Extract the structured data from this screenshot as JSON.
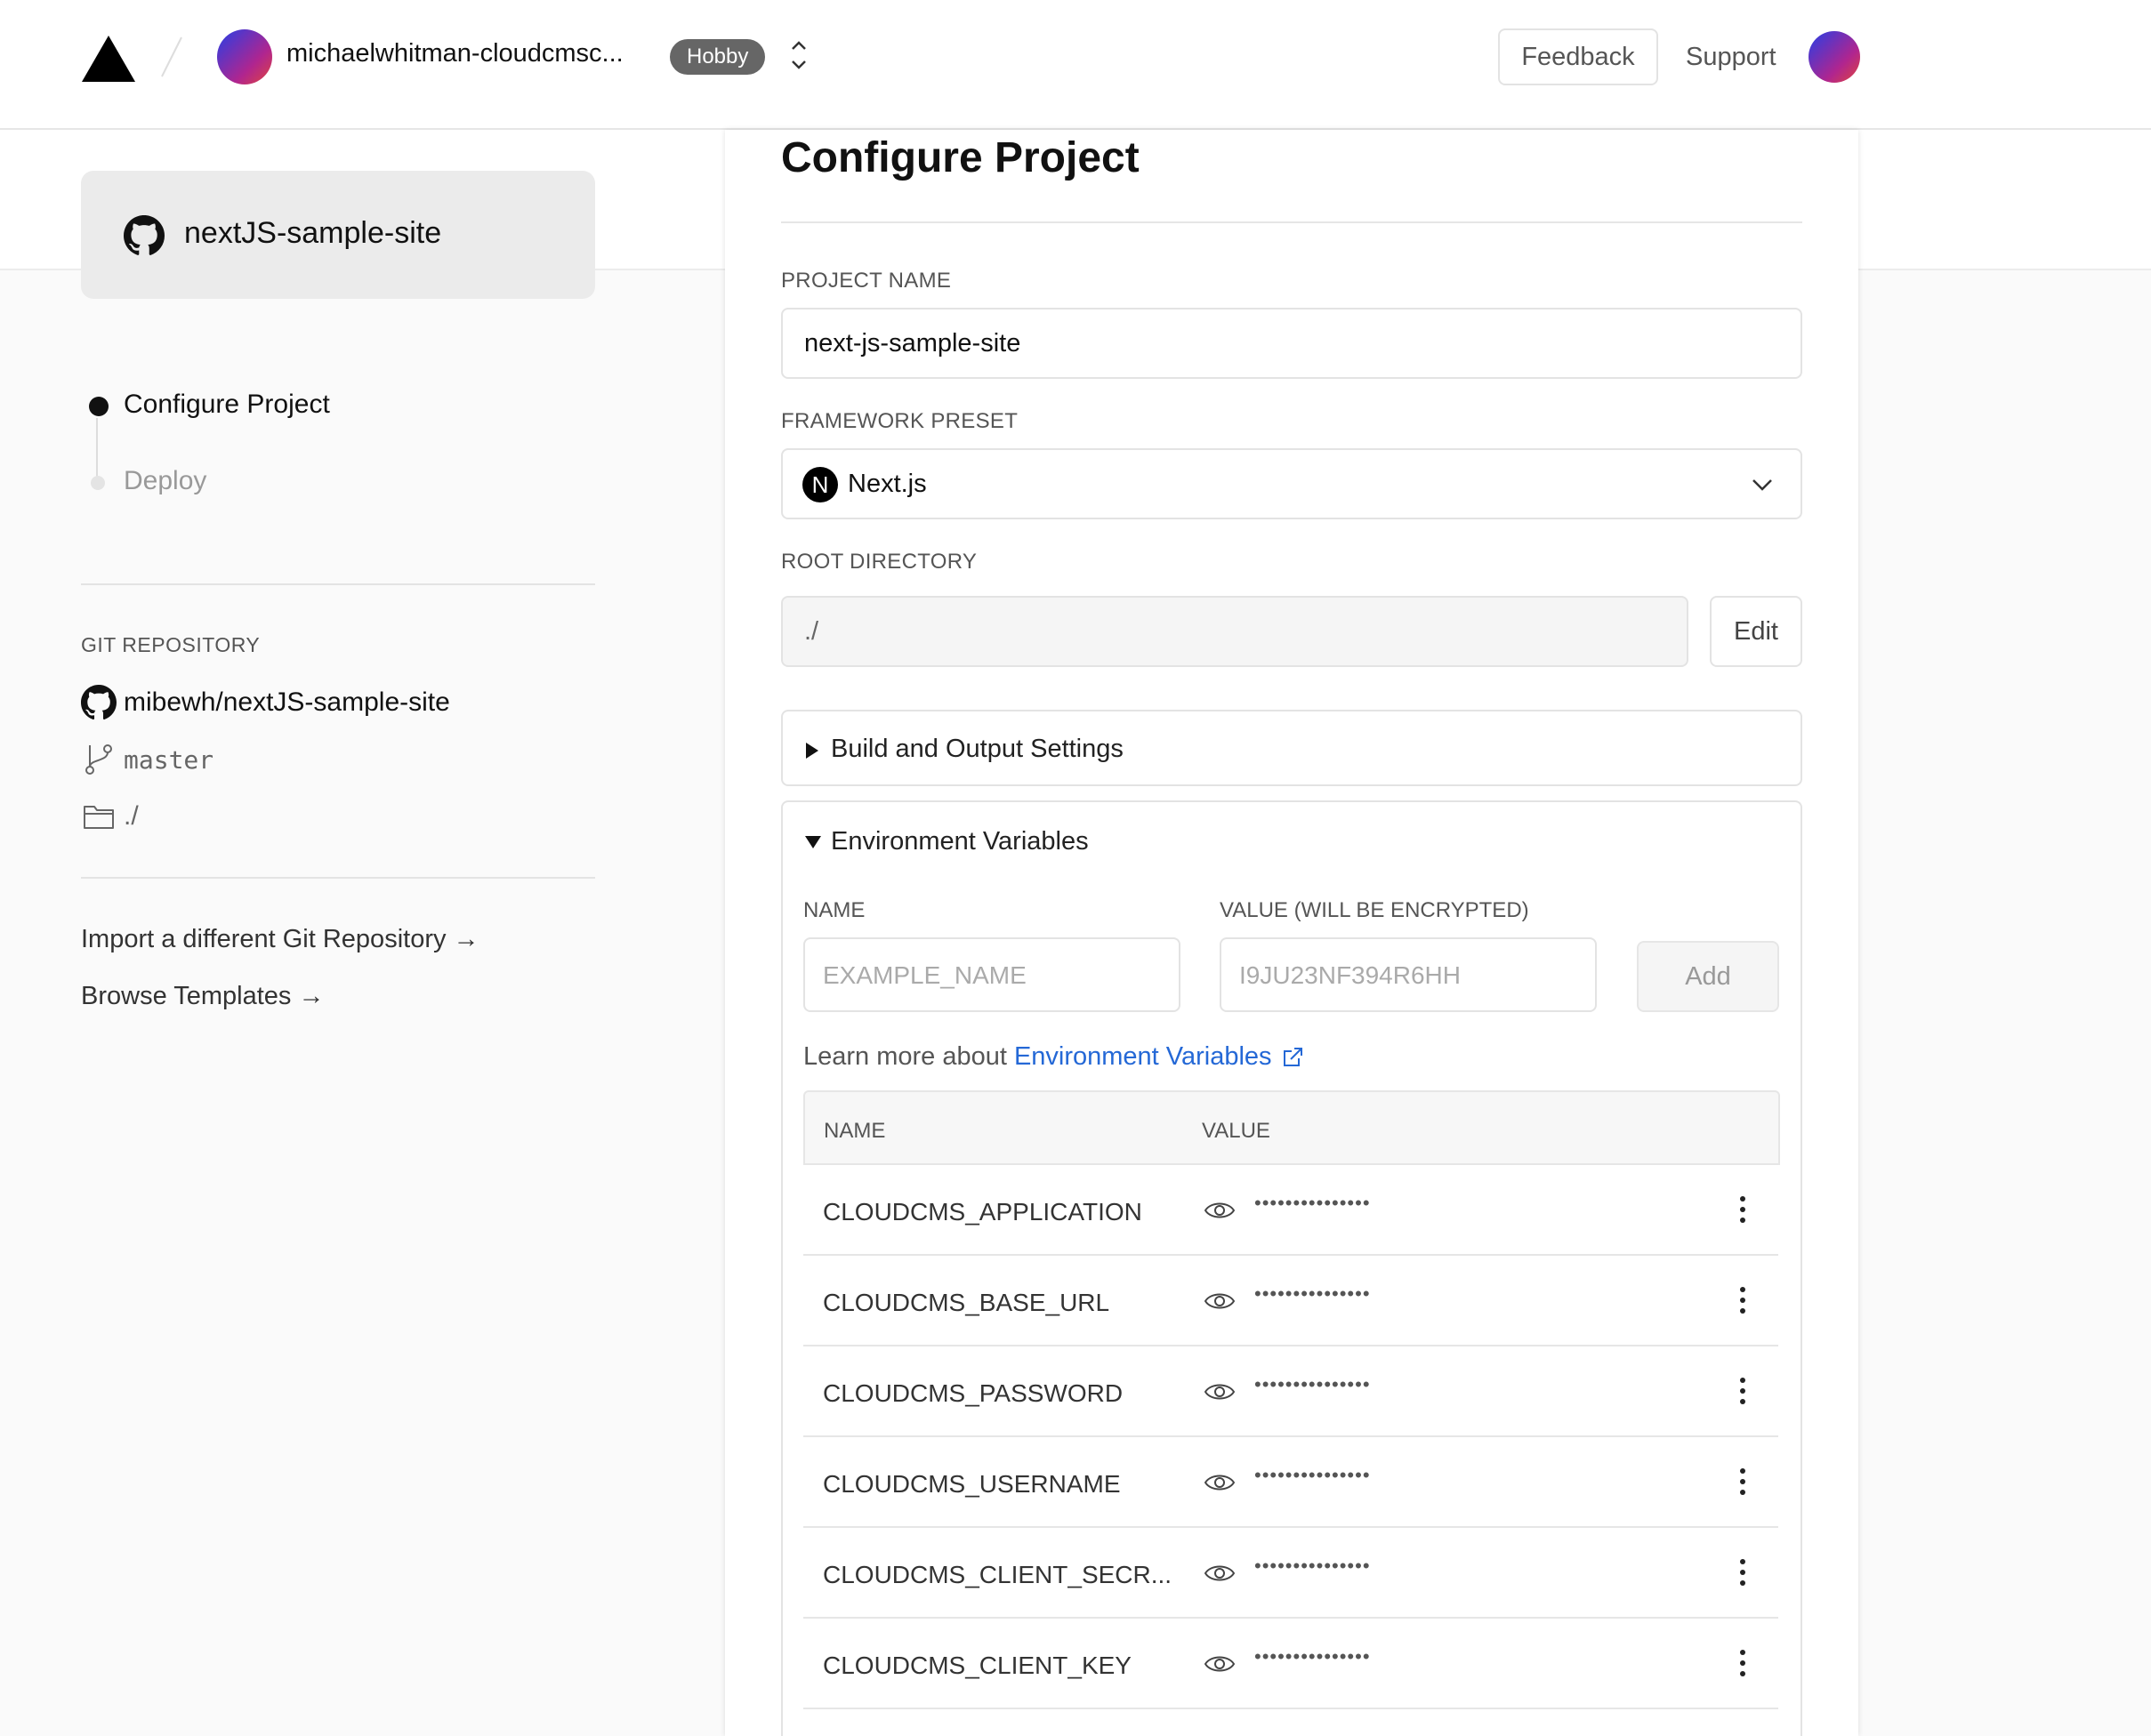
{
  "header": {
    "team_name": "michaelwhitman-cloudcmsc...",
    "plan_badge": "Hobby",
    "feedback_label": "Feedback",
    "support_label": "Support",
    "icons": {
      "logo": "vercel-triangle-icon",
      "switch": "chevron-up-down-icon"
    }
  },
  "sidebar": {
    "repo_card_title": "nextJS-sample-site",
    "steps": [
      {
        "label": "Configure Project",
        "state": "active"
      },
      {
        "label": "Deploy",
        "state": "pending"
      }
    ],
    "git": {
      "heading": "GIT REPOSITORY",
      "repo": "mibewh/nextJS-sample-site",
      "branch": "master",
      "directory": "./"
    },
    "links": {
      "import": "Import a different Git Repository →",
      "templates": "Browse Templates →"
    }
  },
  "main": {
    "title": "Configure Project",
    "project_name": {
      "label": "PROJECT NAME",
      "value": "next-js-sample-site"
    },
    "framework": {
      "label": "FRAMEWORK PRESET",
      "value": "Next.js",
      "badge": "N"
    },
    "root_directory": {
      "label": "ROOT DIRECTORY",
      "value": "./",
      "edit_label": "Edit"
    },
    "build_settings": {
      "label": "Build and Output Settings",
      "expanded": false
    },
    "env": {
      "label": "Environment Variables",
      "expanded": true,
      "name_label": "NAME",
      "value_label": "VALUE (WILL BE ENCRYPTED)",
      "name_placeholder": "EXAMPLE_NAME",
      "value_placeholder": "I9JU23NF394R6HH",
      "add_label": "Add",
      "learn_prefix": "Learn more about",
      "learn_link": "Environment Variables",
      "table": {
        "col_name": "NAME",
        "col_value": "VALUE",
        "rows": [
          {
            "name": "CLOUDCMS_APPLICATION",
            "value": "•••••••••••••••"
          },
          {
            "name": "CLOUDCMS_BASE_URL",
            "value": "•••••••••••••••"
          },
          {
            "name": "CLOUDCMS_PASSWORD",
            "value": "•••••••••••••••"
          },
          {
            "name": "CLOUDCMS_USERNAME",
            "value": "•••••••••••••••"
          },
          {
            "name": "CLOUDCMS_CLIENT_SECR...",
            "value": "•••••••••••••••"
          },
          {
            "name": "CLOUDCMS_CLIENT_KEY",
            "value": "•••••••••••••••"
          }
        ]
      }
    }
  },
  "colors": {
    "accent_link": "#2468d6",
    "badge_bg": "#666666"
  }
}
